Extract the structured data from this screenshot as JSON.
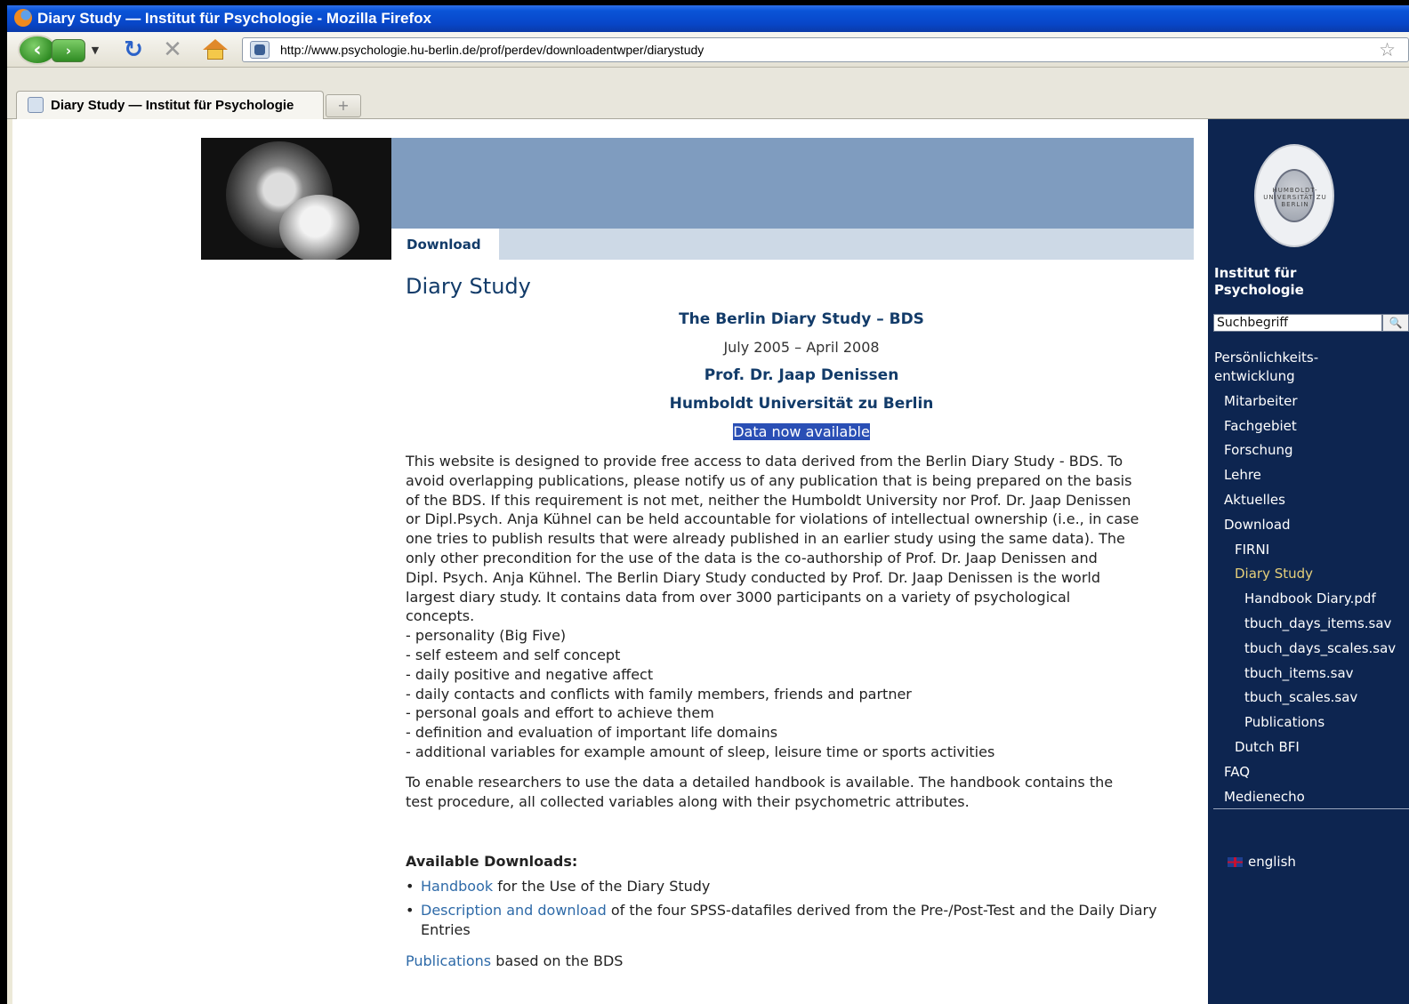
{
  "window": {
    "title": "Diary Study — Institut für Psychologie - Mozilla Firefox"
  },
  "browser": {
    "url": "http://www.psychologie.hu-berlin.de/prof/perdev/downloadentwper/diarystudy",
    "tab_title": "Diary Study — Institut für Psychologie"
  },
  "header": {
    "tab_label": "Download"
  },
  "content": {
    "page_title": "Diary Study",
    "bds_title": "The Berlin Diary Study – BDS",
    "date_range": "July 2005 – April 2008",
    "author": "Prof. Dr. Jaap Denissen",
    "university": "Humboldt Universität zu Berlin",
    "data_available": "Data now available",
    "intro_lines": [
      "This website is designed to provide free access to data derived from the Berlin Diary Study - BDS. To",
      "avoid overlapping publications, please notify us of any publication that is being prepared on the basis",
      "of the BDS. If this requirement is not met, neither the Humboldt University nor Prof. Dr. Jaap Denissen",
      "or Dipl.Psych. Anja Kühnel can be held accountable for violations of intellectual ownership (i.e., in case",
      "one tries to publish results that were already published in an earlier study using the same data). The",
      "only other precondition for the use of the data is the co-authorship of Prof. Dr. Jaap Denissen and",
      "Dipl. Psych. Anja Kühnel. The Berlin Diary Study conducted by Prof. Dr. Jaap Denissen is the world",
      "largest diary study. It contains data from over 3000 participants on a variety of psychological",
      "concepts."
    ],
    "concepts": [
      "- personality (Big Five)",
      "- self esteem and self concept",
      "- daily positive and negative affect",
      "- daily contacts and conflicts with family members, friends and partner",
      "- personal goals and effort to achieve them",
      "- definition and evaluation of important life domains",
      "- additional variables for example amount of sleep, leisure time or sports activities"
    ],
    "handbook_lines": [
      "To enable researchers to use the data a detailed handbook is available. The handbook contains the",
      "test procedure, all collected variables along with their psychometric attributes."
    ],
    "downloads_heading": "Available Downloads:",
    "downloads": [
      {
        "link": "Handbook",
        "text": " for the Use of the Diary Study"
      },
      {
        "link": "Description and download",
        "text": " of the four SPSS-datafiles derived from the Pre-/Post-Test and the Daily Diary Entries"
      }
    ],
    "publications_link": "Publications",
    "publications_text": " based on the BDS"
  },
  "sidebar": {
    "seal_text": "HUMBOLDT-UNIVERSITÄT ZU BERLIN",
    "institute_line1": "Institut für",
    "institute_line2": "Psychologie",
    "search_value": "Suchbegriff",
    "nav": [
      {
        "label": "Persönlichkeits-",
        "level": 0
      },
      {
        "label": "entwicklung",
        "level": 0
      },
      {
        "label": "Mitarbeiter",
        "level": 1
      },
      {
        "label": "Fachgebiet",
        "level": 1
      },
      {
        "label": "Forschung",
        "level": 1
      },
      {
        "label": "Lehre",
        "level": 1
      },
      {
        "label": "Aktuelles",
        "level": 1
      },
      {
        "label": "Download",
        "level": 1
      },
      {
        "label": "FIRNI",
        "level": 2
      },
      {
        "label": "Diary Study",
        "level": 2,
        "active": true
      },
      {
        "label": "Handbook Diary.pdf",
        "level": 3
      },
      {
        "label": "tbuch_days_items.sav",
        "level": 3
      },
      {
        "label": "tbuch_days_scales.sav",
        "level": 3
      },
      {
        "label": "tbuch_items.sav",
        "level": 3
      },
      {
        "label": "tbuch_scales.sav",
        "level": 3
      },
      {
        "label": "Publications",
        "level": 3
      },
      {
        "label": "Dutch BFI",
        "level": 2
      },
      {
        "label": "FAQ",
        "level": 1
      },
      {
        "label": "Medienecho",
        "level": 1
      }
    ],
    "language": "english"
  },
  "colors": {
    "sidebar_bg": "#0d2550",
    "header_band": "#7f9cbf",
    "heading_blue": "#123b69",
    "link_blue": "#2e6aa8",
    "active_nav": "#e6cf7a"
  },
  "icons": [
    "firefox-icon",
    "back-icon",
    "forward-icon",
    "history-dropdown-icon",
    "reload-icon",
    "stop-icon",
    "home-icon",
    "site-icon",
    "bookmark-star-icon",
    "new-tab-icon",
    "search-icon",
    "uk-flag-icon",
    "university-seal"
  ]
}
